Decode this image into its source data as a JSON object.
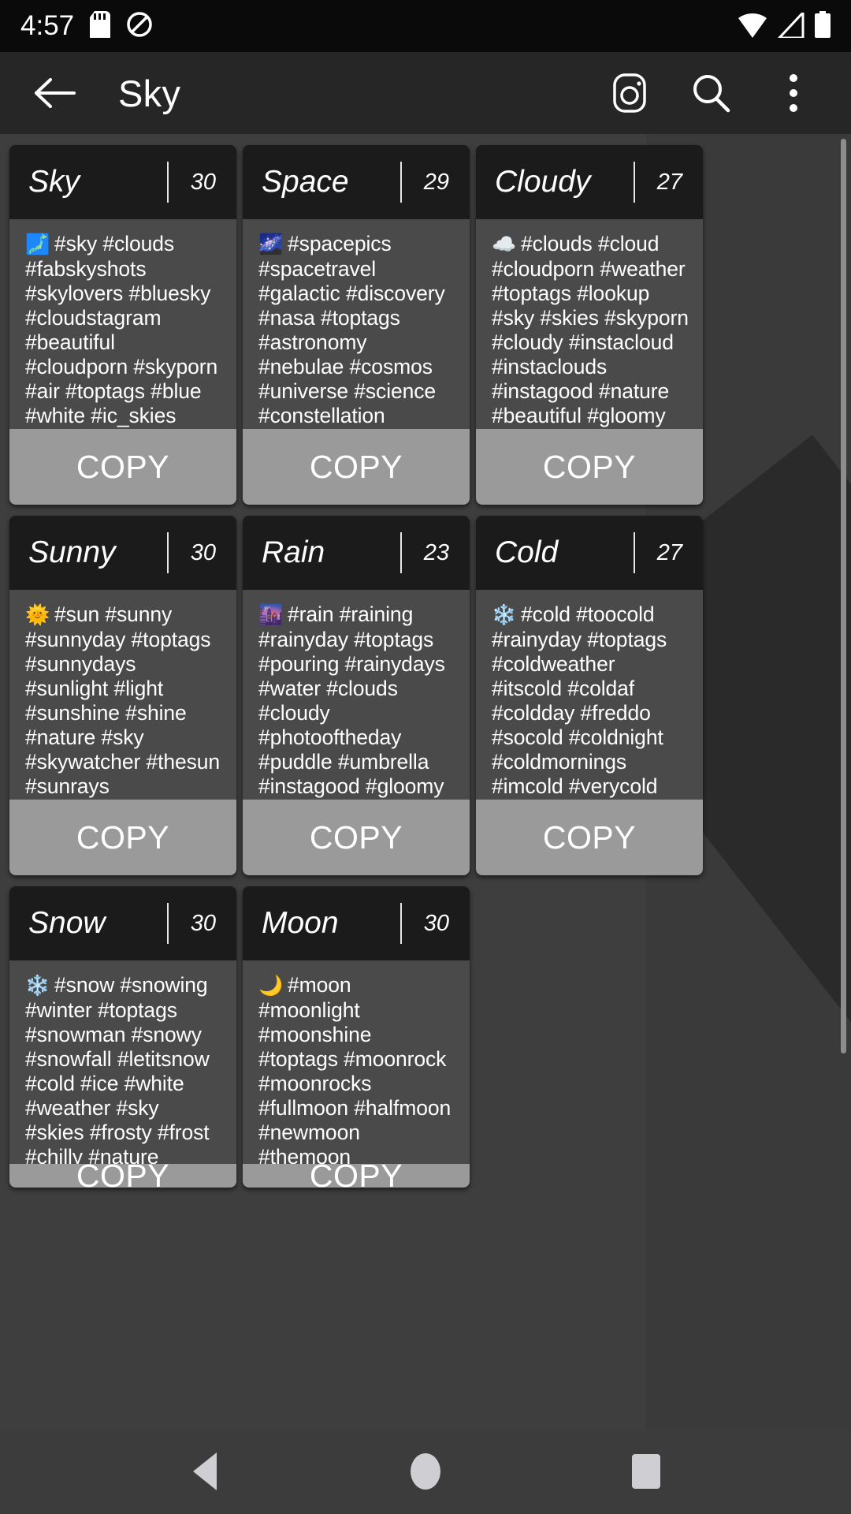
{
  "status_bar": {
    "time": "4:57",
    "icons": [
      "sd-card-icon",
      "do-not-disturb-icon",
      "wifi-icon",
      "cellular-signal-icon",
      "battery-icon"
    ]
  },
  "app_bar": {
    "back_label": "back-arrow-icon",
    "title": "Sky",
    "actions": [
      "instagram-icon",
      "search-icon",
      "overflow-menu-icon"
    ]
  },
  "cards": [
    {
      "title": "Sky",
      "count": "30",
      "emoji": "🗾",
      "tags": "#sky #clouds #fabskyshots #skylovers #bluesky #cloudstagram #beautiful #cloudporn #skyporn #air #toptags #blue #white #ic_skies #beauty #global_sky #skysnappers #skieshunter #igworldsky #thebestskyever #iskyhub …",
      "copy_label": "COPY"
    },
    {
      "title": "Space",
      "count": "29",
      "emoji": "🌌",
      "tags": "#spacepics #spacetravel #galactic #discovery #nasa #toptags #astronomy #nebulae #cosmos #universe #science #constellation #universe #spacetime #outerspace #space #nightsky #galaxy #nasabeyond #deepsky #…",
      "copy_label": "COPY"
    },
    {
      "title": "Cloudy",
      "count": "27",
      "emoji": "☁️",
      "tags": "#clouds #cloud #cloudporn #weather #toptags #lookup #sky #skies #skyporn #cloudy #instacloud #instaclouds #instagood #nature #beautiful #gloomy #skyline #horizon #overcast #instasky #epicsky #crazyclouds #p…",
      "copy_label": "COPY"
    },
    {
      "title": "Sunny",
      "count": "30",
      "emoji": "🌞",
      "tags": "#sun #sunny #sunnyday #toptags #sunnydays #sunlight #light #sunshine #shine #nature #sky #skywatcher #thesun #sunrays #photooftheday #beautiful #beautifulday #weather #summer #goodday #goodweather #instasunny #instasun #in…",
      "copy_label": "COPY"
    },
    {
      "title": "Rain",
      "count": "23",
      "emoji": "🌆",
      "tags": "#rain #raining #rainyday #toptags #pouring #rainydays #water #clouds #cloudy #photooftheday #puddle #umbrella #instagood #gloomy #rainyweather #rainydayz #splash #downpour #instarain #sky #moment #amazing #instadaily",
      "copy_label": "COPY"
    },
    {
      "title": "Cold",
      "count": "27",
      "emoji": "❄️",
      "tags": "#cold #toocold #rainyday #toptags #coldweather #itscold #coldaf #coldday #freddo #socold #coldnight #coldmornings #imcold #verycold #instalike #instalikes #instacold #supercold #gettingcold #feelingcold #freezing #t…",
      "copy_label": "COPY"
    },
    {
      "title": "Snow",
      "count": "30",
      "emoji": "❄️",
      "tags": "#snow #snowing #winter #toptags #snowman #snowy #snowfall #letitsnow #cold #ice #white #weather #sky #skies #frosty #frost #chilly #nature #snowflakes #instagood #wintertime #winterwonderland #whiteworld #joy #instawi…",
      "copy_label": "COPY"
    },
    {
      "title": "Moon",
      "count": "30",
      "emoji": "🌙",
      "tags": "#moon #moonlight #moonshine #toptags #moonrock #moonrocks #fullmoon #halfmoon #newmoon #themoon #goodnightmoon #mooney #sky #skies #moonphases #moonlovers #moonrise #nature #instamoon #ig_moon #nightsky #luna…",
      "copy_label": "COPY"
    }
  ],
  "nav_bar": {
    "back": "back-triangle-icon",
    "home": "home-circle-icon",
    "recents": "recents-square-icon"
  }
}
